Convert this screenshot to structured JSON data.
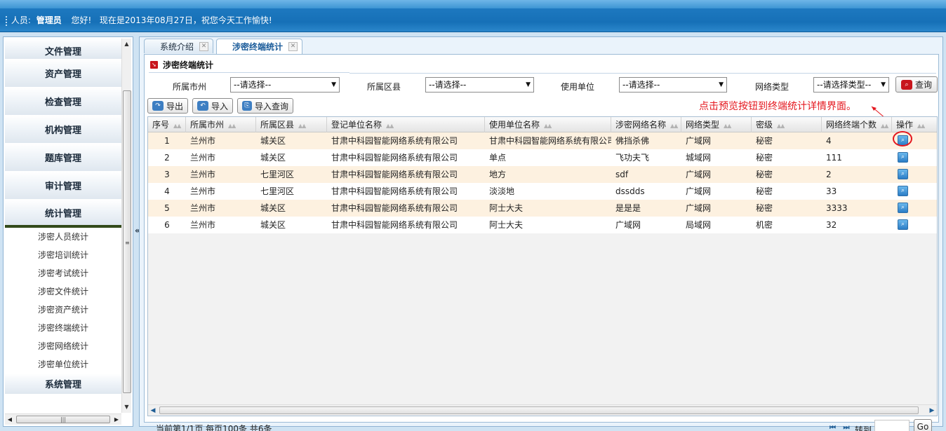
{
  "header": {
    "user_label": "人员:",
    "user_name": "管理员",
    "greeting": "您好!",
    "date_text": "现在是2013年08月27日，祝您今天工作愉快!"
  },
  "sidebar": {
    "sections": [
      {
        "label": "文件管理"
      },
      {
        "label": "资产管理"
      },
      {
        "label": "检查管理"
      },
      {
        "label": "机构管理"
      },
      {
        "label": "题库管理"
      },
      {
        "label": "审计管理"
      },
      {
        "label": "统计管理"
      }
    ],
    "sub_items": [
      {
        "label": "涉密人员统计"
      },
      {
        "label": "涉密培训统计"
      },
      {
        "label": "涉密考试统计"
      },
      {
        "label": "涉密文件统计"
      },
      {
        "label": "涉密资产统计"
      },
      {
        "label": "涉密终端统计"
      },
      {
        "label": "涉密网络统计"
      },
      {
        "label": "涉密单位统计"
      }
    ],
    "last_section": "系统管理",
    "collapse_glyph": "«"
  },
  "tabs": [
    {
      "label": "系统介绍",
      "active": false
    },
    {
      "label": "涉密终端统计",
      "active": true
    }
  ],
  "section_title": "涉密终端统计",
  "filters": {
    "city_label": "所属市州",
    "city_value": "--请选择--",
    "district_label": "所属区县",
    "district_value": "--请选择--",
    "unit_label": "使用单位",
    "unit_value": "--请选择--",
    "net_type_label": "网络类型",
    "net_type_value": "--请选择类型--",
    "query_label": "查询"
  },
  "toolbar": {
    "export_label": "导出",
    "import_label": "导入",
    "import_query_label": "导入查询"
  },
  "annotation": "点击预览按钮到终端统计详情界面。",
  "grid": {
    "columns": [
      "序号",
      "所属市州",
      "所属区县",
      "登记单位名称",
      "使用单位名称",
      "涉密网络名称",
      "网络类型",
      "密级",
      "网络终端个数",
      "操作"
    ],
    "rows": [
      [
        "1",
        "兰州市",
        "城关区",
        "甘肃中科园智能网络系统有限公司",
        "甘肃中科园智能网络系统有限公司",
        "佛挡杀佛",
        "广域网",
        "秘密",
        "4"
      ],
      [
        "2",
        "兰州市",
        "城关区",
        "甘肃中科园智能网络系统有限公司",
        "单点",
        "飞功夫飞",
        "城域网",
        "秘密",
        "111"
      ],
      [
        "3",
        "兰州市",
        "七里河区",
        "甘肃中科园智能网络系统有限公司",
        "地方",
        "sdf",
        "广域网",
        "秘密",
        "2"
      ],
      [
        "4",
        "兰州市",
        "七里河区",
        "甘肃中科园智能网络系统有限公司",
        "淡淡地",
        "dssdds",
        "广域网",
        "秘密",
        "33"
      ],
      [
        "5",
        "兰州市",
        "城关区",
        "甘肃中科园智能网络系统有限公司",
        "阿士大夫",
        "是是是",
        "广域网",
        "秘密",
        "3333"
      ],
      [
        "6",
        "兰州市",
        "城关区",
        "甘肃中科园智能网络系统有限公司",
        "阿士大夫",
        "广域网",
        "局域网",
        "机密",
        "32"
      ]
    ],
    "action_icon": "search-icon"
  },
  "pager": {
    "info": "当前第1/1页  每页100条  共6条",
    "first_glyph": "⏮",
    "last_glyph": "⏭",
    "goto_label": "转到",
    "go_label": "Go"
  },
  "colors": {
    "header_blue": "#1d78bf",
    "odd_row": "#fdf1e0",
    "annotation_red": "#e4161d",
    "active_tab_text": "#1a5b9a"
  }
}
